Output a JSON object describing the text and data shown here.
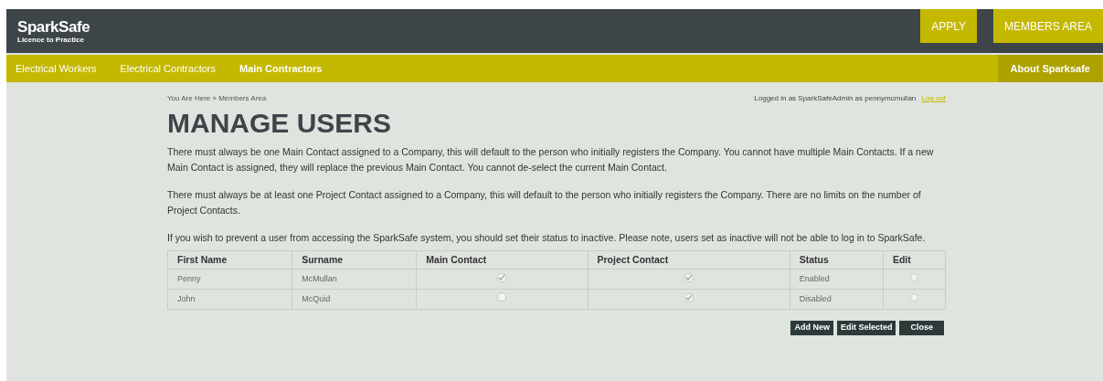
{
  "header": {
    "logo": "SparkSafe",
    "tagline": "Licence to Practice",
    "buttons": [
      "APPLY",
      "MEMBERS AREA"
    ]
  },
  "nav": {
    "items": [
      {
        "label": "Electrical Workers"
      },
      {
        "label": "Electrical Contractors"
      },
      {
        "label": "Main Contractors"
      }
    ],
    "right_item": "About Sparksafe"
  },
  "breadcrumb": "You Are Here » Members Area",
  "login": {
    "text": "Logged in as SparkSafeAdmin as pennymcmullan",
    "link": "Log out"
  },
  "title": "MANAGE USERS",
  "paragraphs": [
    "There must always be one Main Contact assigned to a Company, this will default to the person who initially registers the Company. You cannot have multiple Main Contacts. If a new Main Contact is assigned, they will replace the previous Main Contact. You cannot de-select the current Main Contact.",
    "There must always be at least one Project Contact assigned to a Company, this will default to the person who initially registers the Company. There are no limits on the number of Project Contacts.",
    "If you wish to prevent a user from accessing the SparkSafe system, you should set their status to inactive. Please note, users set as inactive will not be able to log in to SparkSafe."
  ],
  "table": {
    "columns": [
      "First Name",
      "Surname",
      "Main Contact",
      "Project Contact",
      "Status",
      "Edit"
    ],
    "rows": [
      {
        "first_name": "Penny",
        "surname": "McMullan",
        "main_contact": true,
        "project_contact": true,
        "status": "Enabled",
        "selected": false
      },
      {
        "first_name": "John",
        "surname": "McQuid",
        "main_contact": false,
        "project_contact": true,
        "status": "Disabled",
        "selected": false
      }
    ]
  },
  "actions": [
    "Add New",
    "Edit Selected",
    "Close"
  ]
}
